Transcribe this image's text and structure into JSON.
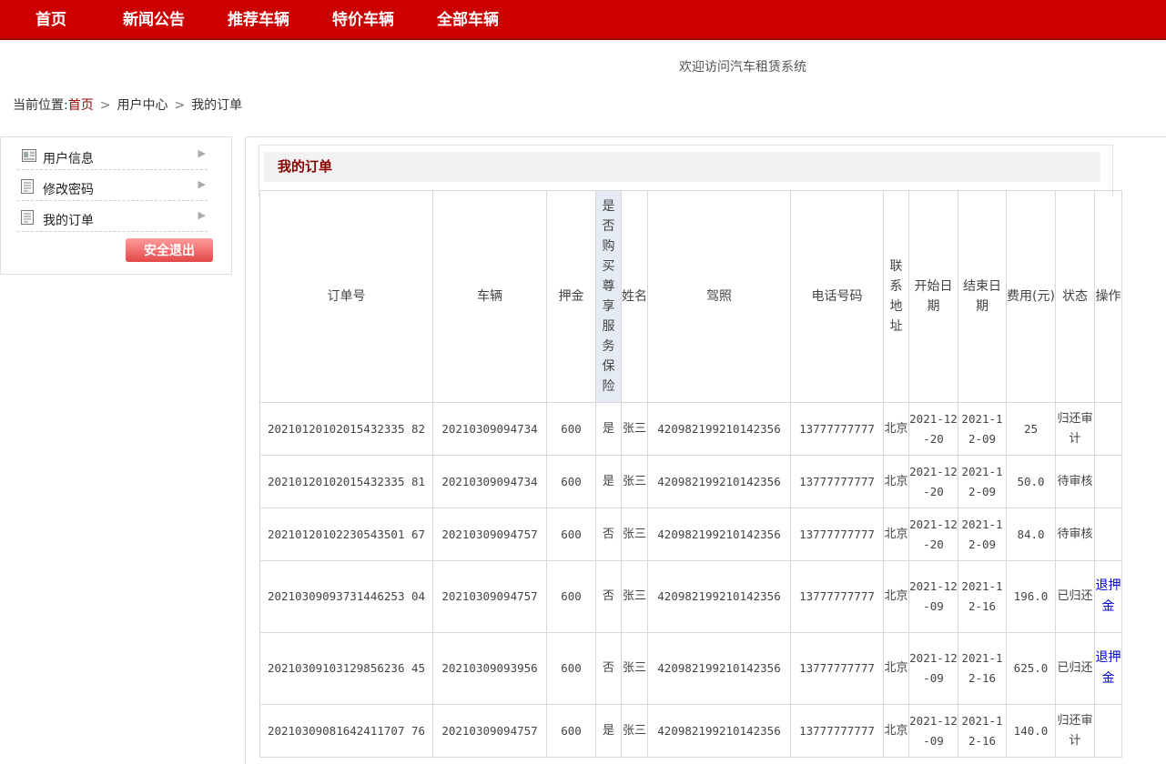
{
  "nav": {
    "items": [
      "首页",
      "新闻公告",
      "推荐车辆",
      "特价车辆",
      "全部车辆"
    ]
  },
  "welcome": "欢迎访问汽车租赁系统",
  "breadcrumb": {
    "prefix": "当前位置:",
    "home": "首页",
    "separator": ">",
    "level2": "用户中心",
    "level3": "我的订单"
  },
  "sidebar": {
    "items": [
      {
        "label": "用户信息",
        "icon": "id-card-icon"
      },
      {
        "label": "修改密码",
        "icon": "document-icon"
      },
      {
        "label": "我的订单",
        "icon": "document-icon"
      }
    ],
    "logout": "安全退出"
  },
  "main": {
    "title": "我的订单",
    "table": {
      "headers": [
        "订单号",
        "车辆",
        "押金",
        "是否购买尊享服务保险",
        "姓名",
        "驾照",
        "电话号码",
        "联系地址",
        "开始日期",
        "结束日期",
        "费用(元)",
        "状态",
        "操作"
      ],
      "rows": [
        {
          "order_no": "20210120102015432335 82",
          "vehicle": "20210309094734",
          "deposit": "600",
          "insurance": "是",
          "name": "张三",
          "license": "420982199210142356",
          "phone": "13777777777",
          "address": "北京",
          "start": "2021-12-20",
          "end": "2021-12-09",
          "fee": "25",
          "status": "归还审计",
          "action": ""
        },
        {
          "order_no": "20210120102015432335 81",
          "vehicle": "20210309094734",
          "deposit": "600",
          "insurance": "是",
          "name": "张三",
          "license": "420982199210142356",
          "phone": "13777777777",
          "address": "北京",
          "start": "2021-12-20",
          "end": "2021-12-09",
          "fee": "50.0",
          "status": "待审核",
          "action": ""
        },
        {
          "order_no": "20210120102230543501 67",
          "vehicle": "20210309094757",
          "deposit": "600",
          "insurance": "否",
          "name": "张三",
          "license": "420982199210142356",
          "phone": "13777777777",
          "address": "北京",
          "start": "2021-12-20",
          "end": "2021-12-09",
          "fee": "84.0",
          "status": "待审核",
          "action": ""
        },
        {
          "order_no": "20210309093731446253 04",
          "vehicle": "20210309094757",
          "deposit": "600",
          "insurance": "否",
          "name": "张三",
          "license": "420982199210142356",
          "phone": "13777777777",
          "address": "北京",
          "start": "2021-12-09",
          "end": "2021-12-16",
          "fee": "196.0",
          "status": "已归还",
          "action": "退押金"
        },
        {
          "order_no": "20210309103129856236 45",
          "vehicle": "20210309093956",
          "deposit": "600",
          "insurance": "否",
          "name": "张三",
          "license": "420982199210142356",
          "phone": "13777777777",
          "address": "北京",
          "start": "2021-12-09",
          "end": "2021-12-16",
          "fee": "625.0",
          "status": "已归还",
          "action": "退押金"
        },
        {
          "order_no": "20210309081642411707 76",
          "vehicle": "20210309094757",
          "deposit": "600",
          "insurance": "是",
          "name": "张三",
          "license": "420982199210142356",
          "phone": "13777777777",
          "address": "北京",
          "start": "2021-12-09",
          "end": "2021-12-16",
          "fee": "140.0",
          "status": "归还审计",
          "action": ""
        }
      ]
    }
  }
}
